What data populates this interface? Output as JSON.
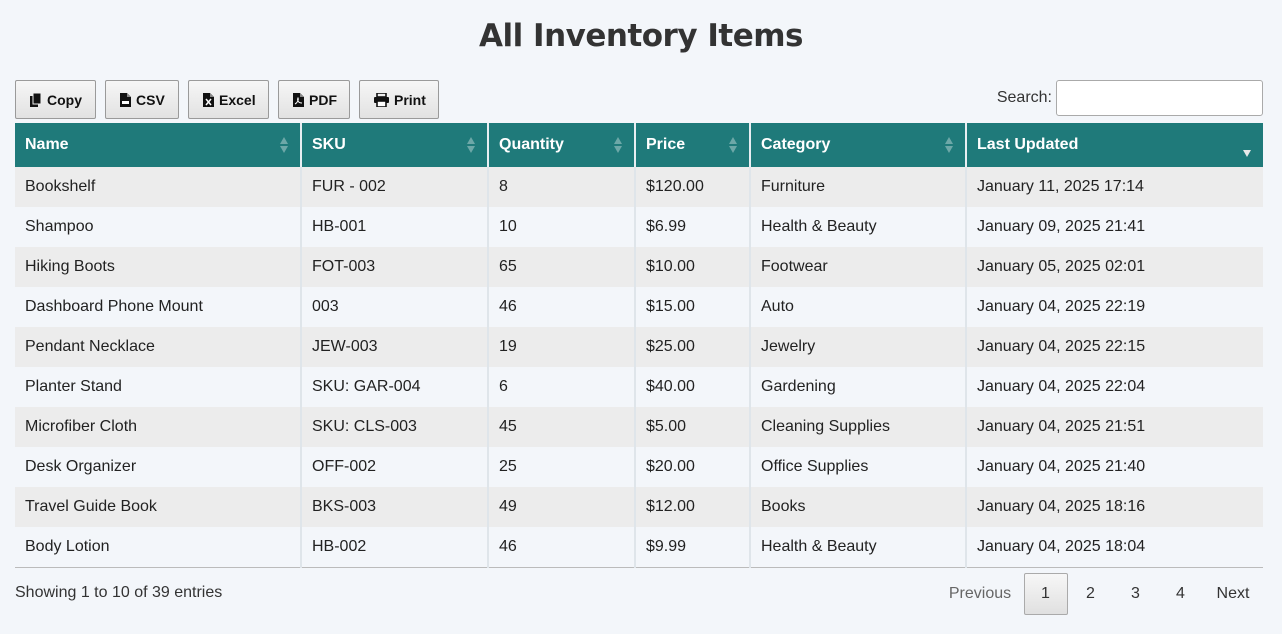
{
  "title": "All Inventory Items",
  "toolbar": {
    "copy": "Copy",
    "csv": "CSV",
    "excel": "Excel",
    "pdf": "PDF",
    "print": "Print"
  },
  "search": {
    "label": "Search:",
    "value": "",
    "placeholder": ""
  },
  "table": {
    "columns": [
      "Name",
      "SKU",
      "Quantity",
      "Price",
      "Category",
      "Last Updated"
    ],
    "sorted_column": "Last Updated",
    "sort_direction": "descending",
    "header_color": "#1f7a7a",
    "rows": [
      [
        "Bookshelf",
        "FUR - 002",
        "8",
        "$120.00",
        "Furniture",
        "January 11, 2025 17:14"
      ],
      [
        "Shampoo",
        "HB-001",
        "10",
        "$6.99",
        "Health & Beauty",
        "January 09, 2025 21:41"
      ],
      [
        "Hiking Boots",
        "FOT-003",
        "65",
        "$10.00",
        "Footwear",
        "January 05, 2025 02:01"
      ],
      [
        "Dashboard Phone Mount",
        "003",
        "46",
        "$15.00",
        "Auto",
        "January 04, 2025 22:19"
      ],
      [
        "Pendant Necklace",
        "JEW-003",
        "19",
        "$25.00",
        "Jewelry",
        "January 04, 2025 22:15"
      ],
      [
        "Planter Stand",
        "SKU: GAR-004",
        "6",
        "$40.00",
        "Gardening",
        "January 04, 2025 22:04"
      ],
      [
        "Microfiber Cloth",
        "SKU: CLS-003",
        "45",
        "$5.00",
        "Cleaning Supplies",
        "January 04, 2025 21:51"
      ],
      [
        "Desk Organizer",
        "OFF-002",
        "25",
        "$20.00",
        "Office Supplies",
        "January 04, 2025 21:40"
      ],
      [
        "Travel Guide Book",
        "BKS-003",
        "49",
        "$12.00",
        "Books",
        "January 04, 2025 18:16"
      ],
      [
        "Body Lotion",
        "HB-002",
        "46",
        "$9.99",
        "Health & Beauty",
        "January 04, 2025 18:04"
      ]
    ]
  },
  "info": "Showing 1 to 10 of 39 entries",
  "pagination": {
    "previous": "Previous",
    "pages": [
      "1",
      "2",
      "3",
      "4"
    ],
    "current": "1",
    "next": "Next"
  }
}
